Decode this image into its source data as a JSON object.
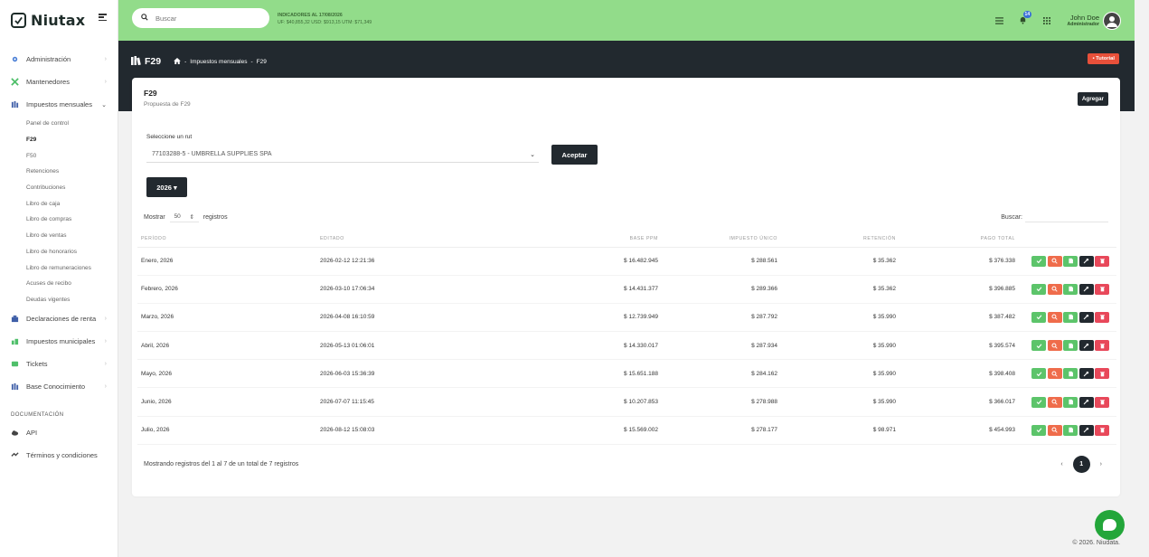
{
  "brand": {
    "name": "Niutax"
  },
  "sidebar": {
    "items": [
      {
        "label": "Administración",
        "icon": "gear-icon"
      },
      {
        "label": "Mantenedores",
        "icon": "tools-icon"
      },
      {
        "label": "Impuestos mensuales",
        "icon": "books-icon"
      }
    ],
    "sub_items": [
      "Panel de control",
      "F29",
      "F50",
      "Retenciones",
      "Contribuciones",
      "Libro de caja",
      "Libro de compras",
      "Libro de ventas",
      "Libro de honorarios",
      "Libro de remuneraciones",
      "Acuses de recibo",
      "Deudas vigentes"
    ],
    "items_after": [
      {
        "label": "Declaraciones de renta",
        "icon": "building-icon"
      },
      {
        "label": "Impuestos municipales",
        "icon": "city-icon"
      },
      {
        "label": "Tickets",
        "icon": "ticket-icon"
      },
      {
        "label": "Base Conocimiento",
        "icon": "books-icon"
      }
    ],
    "doc_section": "DOCUMENTACIÓN",
    "doc_items": [
      {
        "label": "API",
        "icon": "cloud-icon"
      },
      {
        "label": "Términos y condiciones",
        "icon": "handshake-icon"
      }
    ]
  },
  "header": {
    "search_placeholder": "Buscar",
    "indicators_title": "INDICADORES AL 17/08/2026",
    "indicators_values": "UF: $40,855,32   USD: $913,15   UTM: $71,349",
    "notifications_count": "14",
    "user_name": "John Doe",
    "user_role": "Administrador"
  },
  "band": {
    "title": "F29",
    "crumb_section": "Impuestos mensuales",
    "crumb_sep": "-",
    "crumb_current": "F29",
    "tutorial": "Tutorial"
  },
  "card": {
    "title": "F29",
    "subtitle": "Propuesta de F29",
    "add_button": "Agregar",
    "rut_label": "Seleccione un rut",
    "rut_value": "77103288-5 - UMBRELLA SUPPLIES SPA",
    "accept_button": "Aceptar",
    "year": "2026",
    "show_label": "Mostrar",
    "show_value": "50",
    "records_label": "registros",
    "search_label": "Buscar:",
    "columns": [
      "PERÍODO",
      "EDITADO",
      "BASE PPM",
      "IMPUESTO ÚNICO",
      "RETENCIÓN",
      "PAGO TOTAL"
    ],
    "rows": [
      {
        "periodo": "Enero, 2026",
        "editado": "2026-02-12 12:21:36",
        "base": "$ 16.482.945",
        "impuesto": "$ 288.561",
        "retencion": "$ 35.362",
        "total": "$ 376.338"
      },
      {
        "periodo": "Febrero, 2026",
        "editado": "2026-03-10 17:06:34",
        "base": "$ 14.431.377",
        "impuesto": "$ 289.366",
        "retencion": "$ 35.362",
        "total": "$ 396.885"
      },
      {
        "periodo": "Marzo, 2026",
        "editado": "2026-04-08 16:10:59",
        "base": "$ 12.739.949",
        "impuesto": "$ 287.792",
        "retencion": "$ 35.990",
        "total": "$ 387.482"
      },
      {
        "periodo": "Abril, 2026",
        "editado": "2026-05-13 01:06:01",
        "base": "$ 14.330.017",
        "impuesto": "$ 287.934",
        "retencion": "$ 35.990",
        "total": "$ 395.574"
      },
      {
        "periodo": "Mayo, 2026",
        "editado": "2026-06-03 15:36:39",
        "base": "$ 15.651.188",
        "impuesto": "$ 284.162",
        "retencion": "$ 35.990",
        "total": "$ 398.408"
      },
      {
        "periodo": "Junio, 2026",
        "editado": "2026-07-07 11:15:45",
        "base": "$ 10.207.853",
        "impuesto": "$ 278.988",
        "retencion": "$ 35.990",
        "total": "$ 366.017"
      },
      {
        "periodo": "Julio, 2026",
        "editado": "2026-08-12 15:08:03",
        "base": "$ 15.569.002",
        "impuesto": "$ 278.177",
        "retencion": "$ 98.971",
        "total": "$ 454.993"
      }
    ],
    "info": "Mostrando registros del 1 al 7 de un total de 7 registros",
    "page": "1",
    "prev": "‹",
    "next": "›"
  },
  "footer": "© 2026. Niudata.",
  "colors": {
    "header_green": "#92dc8a",
    "dark": "#22292f",
    "accent_green": "#5cc46a",
    "orange": "#ef6c4b",
    "red": "#e8485a"
  }
}
